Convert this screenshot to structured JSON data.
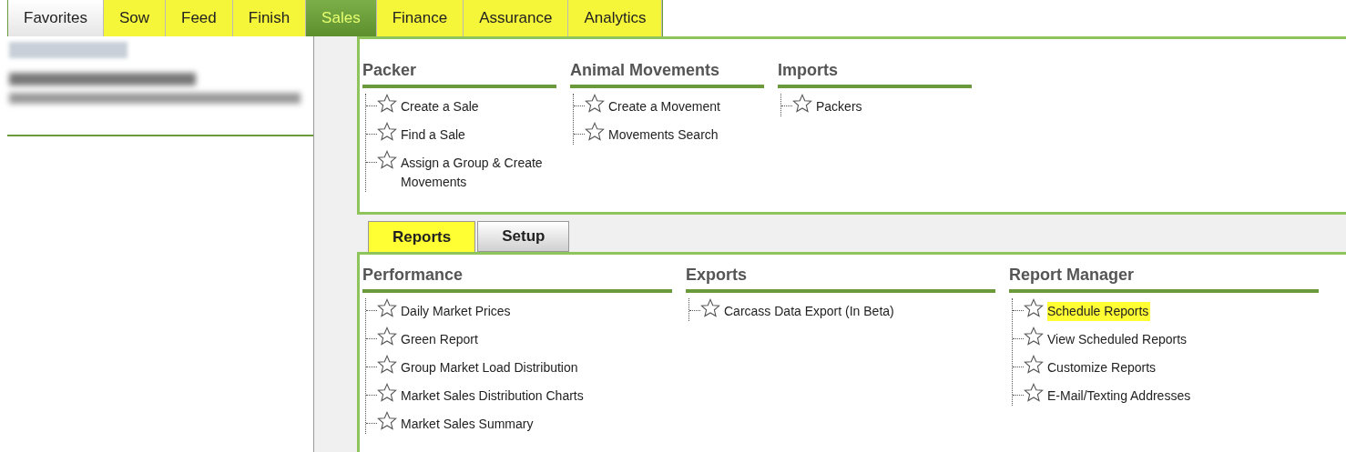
{
  "top_tabs": [
    {
      "label": "Favorites",
      "selected": false,
      "highlighted": false
    },
    {
      "label": "Sow",
      "selected": false,
      "highlighted": true
    },
    {
      "label": "Feed",
      "selected": false,
      "highlighted": true
    },
    {
      "label": "Finish",
      "selected": false,
      "highlighted": true
    },
    {
      "label": "Sales",
      "selected": true,
      "highlighted": true
    },
    {
      "label": "Finance",
      "selected": false,
      "highlighted": true
    },
    {
      "label": "Assurance",
      "selected": false,
      "highlighted": true
    },
    {
      "label": "Analytics",
      "selected": false,
      "highlighted": true
    }
  ],
  "upper_sections": [
    {
      "title": "Packer",
      "items": [
        {
          "label": "Create a Sale",
          "highlighted": false
        },
        {
          "label": "Find a Sale",
          "highlighted": false
        },
        {
          "label": "Assign a Group & Create Movements",
          "highlighted": false
        }
      ]
    },
    {
      "title": "Animal Movements",
      "items": [
        {
          "label": "Create a Movement",
          "highlighted": false
        },
        {
          "label": "Movements Search",
          "highlighted": false
        }
      ]
    },
    {
      "title": "Imports",
      "items": [
        {
          "label": "Packers",
          "highlighted": false
        }
      ]
    }
  ],
  "sub_tabs": [
    {
      "label": "Reports",
      "selected": true,
      "highlighted": true
    },
    {
      "label": "Setup",
      "selected": false,
      "highlighted": false
    }
  ],
  "lower_sections": [
    {
      "title": "Performance",
      "items": [
        {
          "label": "Daily Market Prices",
          "highlighted": false
        },
        {
          "label": "Green Report",
          "highlighted": false
        },
        {
          "label": "Group Market Load Distribution",
          "highlighted": false
        },
        {
          "label": "Market Sales Distribution Charts",
          "highlighted": false
        },
        {
          "label": "Market Sales Summary",
          "highlighted": false
        }
      ]
    },
    {
      "title": "Exports",
      "items": [
        {
          "label": "Carcass Data Export (In Beta)",
          "highlighted": false
        }
      ]
    },
    {
      "title": "Report Manager",
      "items": [
        {
          "label": "Schedule Reports",
          "highlighted": true
        },
        {
          "label": "View Scheduled Reports",
          "highlighted": false
        },
        {
          "label": "Customize Reports",
          "highlighted": false
        },
        {
          "label": "E-Mail/Texting Addresses",
          "highlighted": false
        }
      ]
    }
  ]
}
